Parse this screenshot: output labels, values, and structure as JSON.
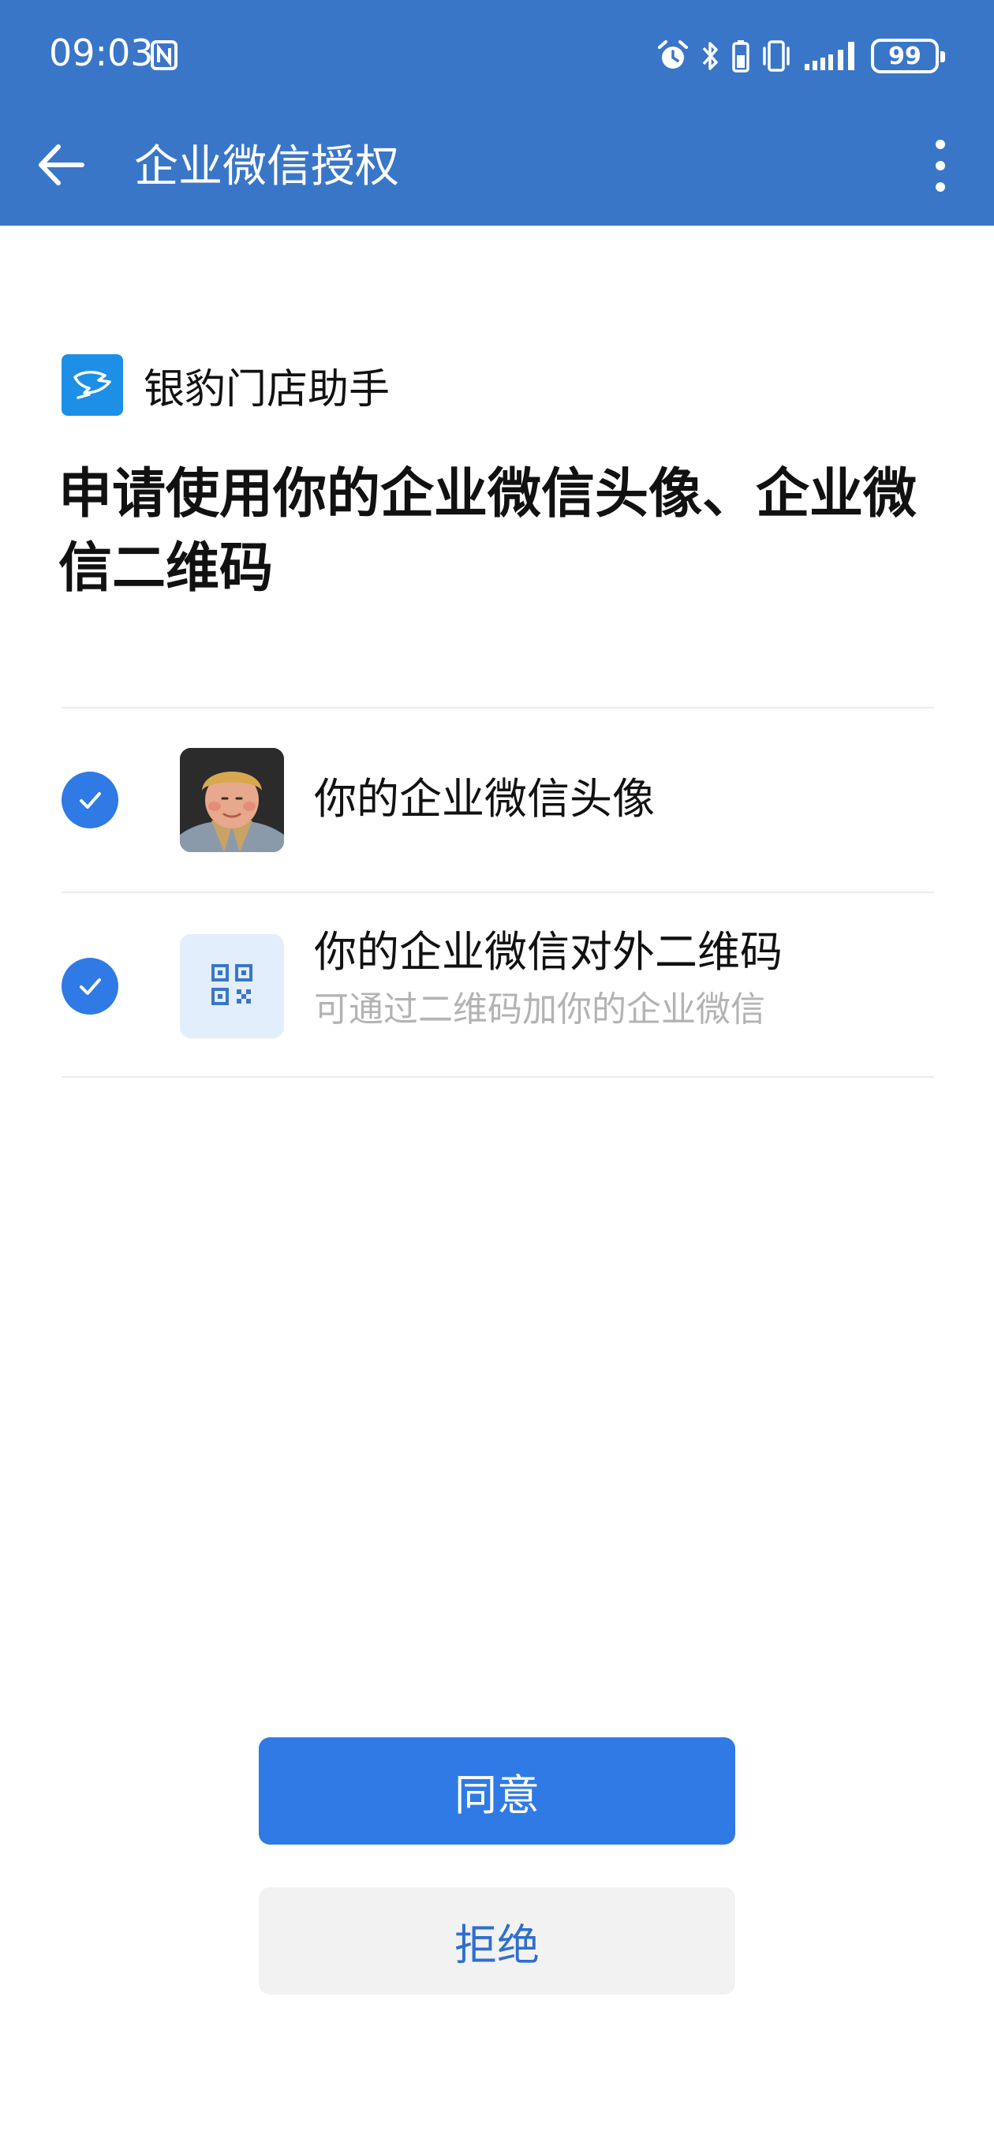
{
  "status_bar": {
    "time": "09:03",
    "battery_level": "99",
    "icons": [
      "nfc-icon",
      "alarm-icon",
      "bluetooth-icon",
      "battery-saver-icon",
      "vibrate-icon",
      "signal-icon",
      "battery-icon"
    ]
  },
  "app_bar": {
    "title": "企业微信授权",
    "back_icon": "back-arrow-icon",
    "more_icon": "more-vertical-icon"
  },
  "app": {
    "name": "银豹门店助手"
  },
  "request": {
    "title": "申请使用你的企业微信头像、企业微信二维码"
  },
  "permissions": [
    {
      "label": "你的企业微信头像",
      "checked": true,
      "thumb": "avatar-photo"
    },
    {
      "label": "你的企业微信对外二维码",
      "description": "可通过二维码加你的企业微信",
      "checked": true,
      "thumb": "qr-code-icon"
    }
  ],
  "actions": {
    "agree_label": "同意",
    "reject_label": "拒绝"
  },
  "colors": {
    "header": "#3a76c8",
    "primary": "#2f7ae5",
    "reject_bg": "#f2f2f2",
    "muted_text": "#b3b3b3"
  }
}
